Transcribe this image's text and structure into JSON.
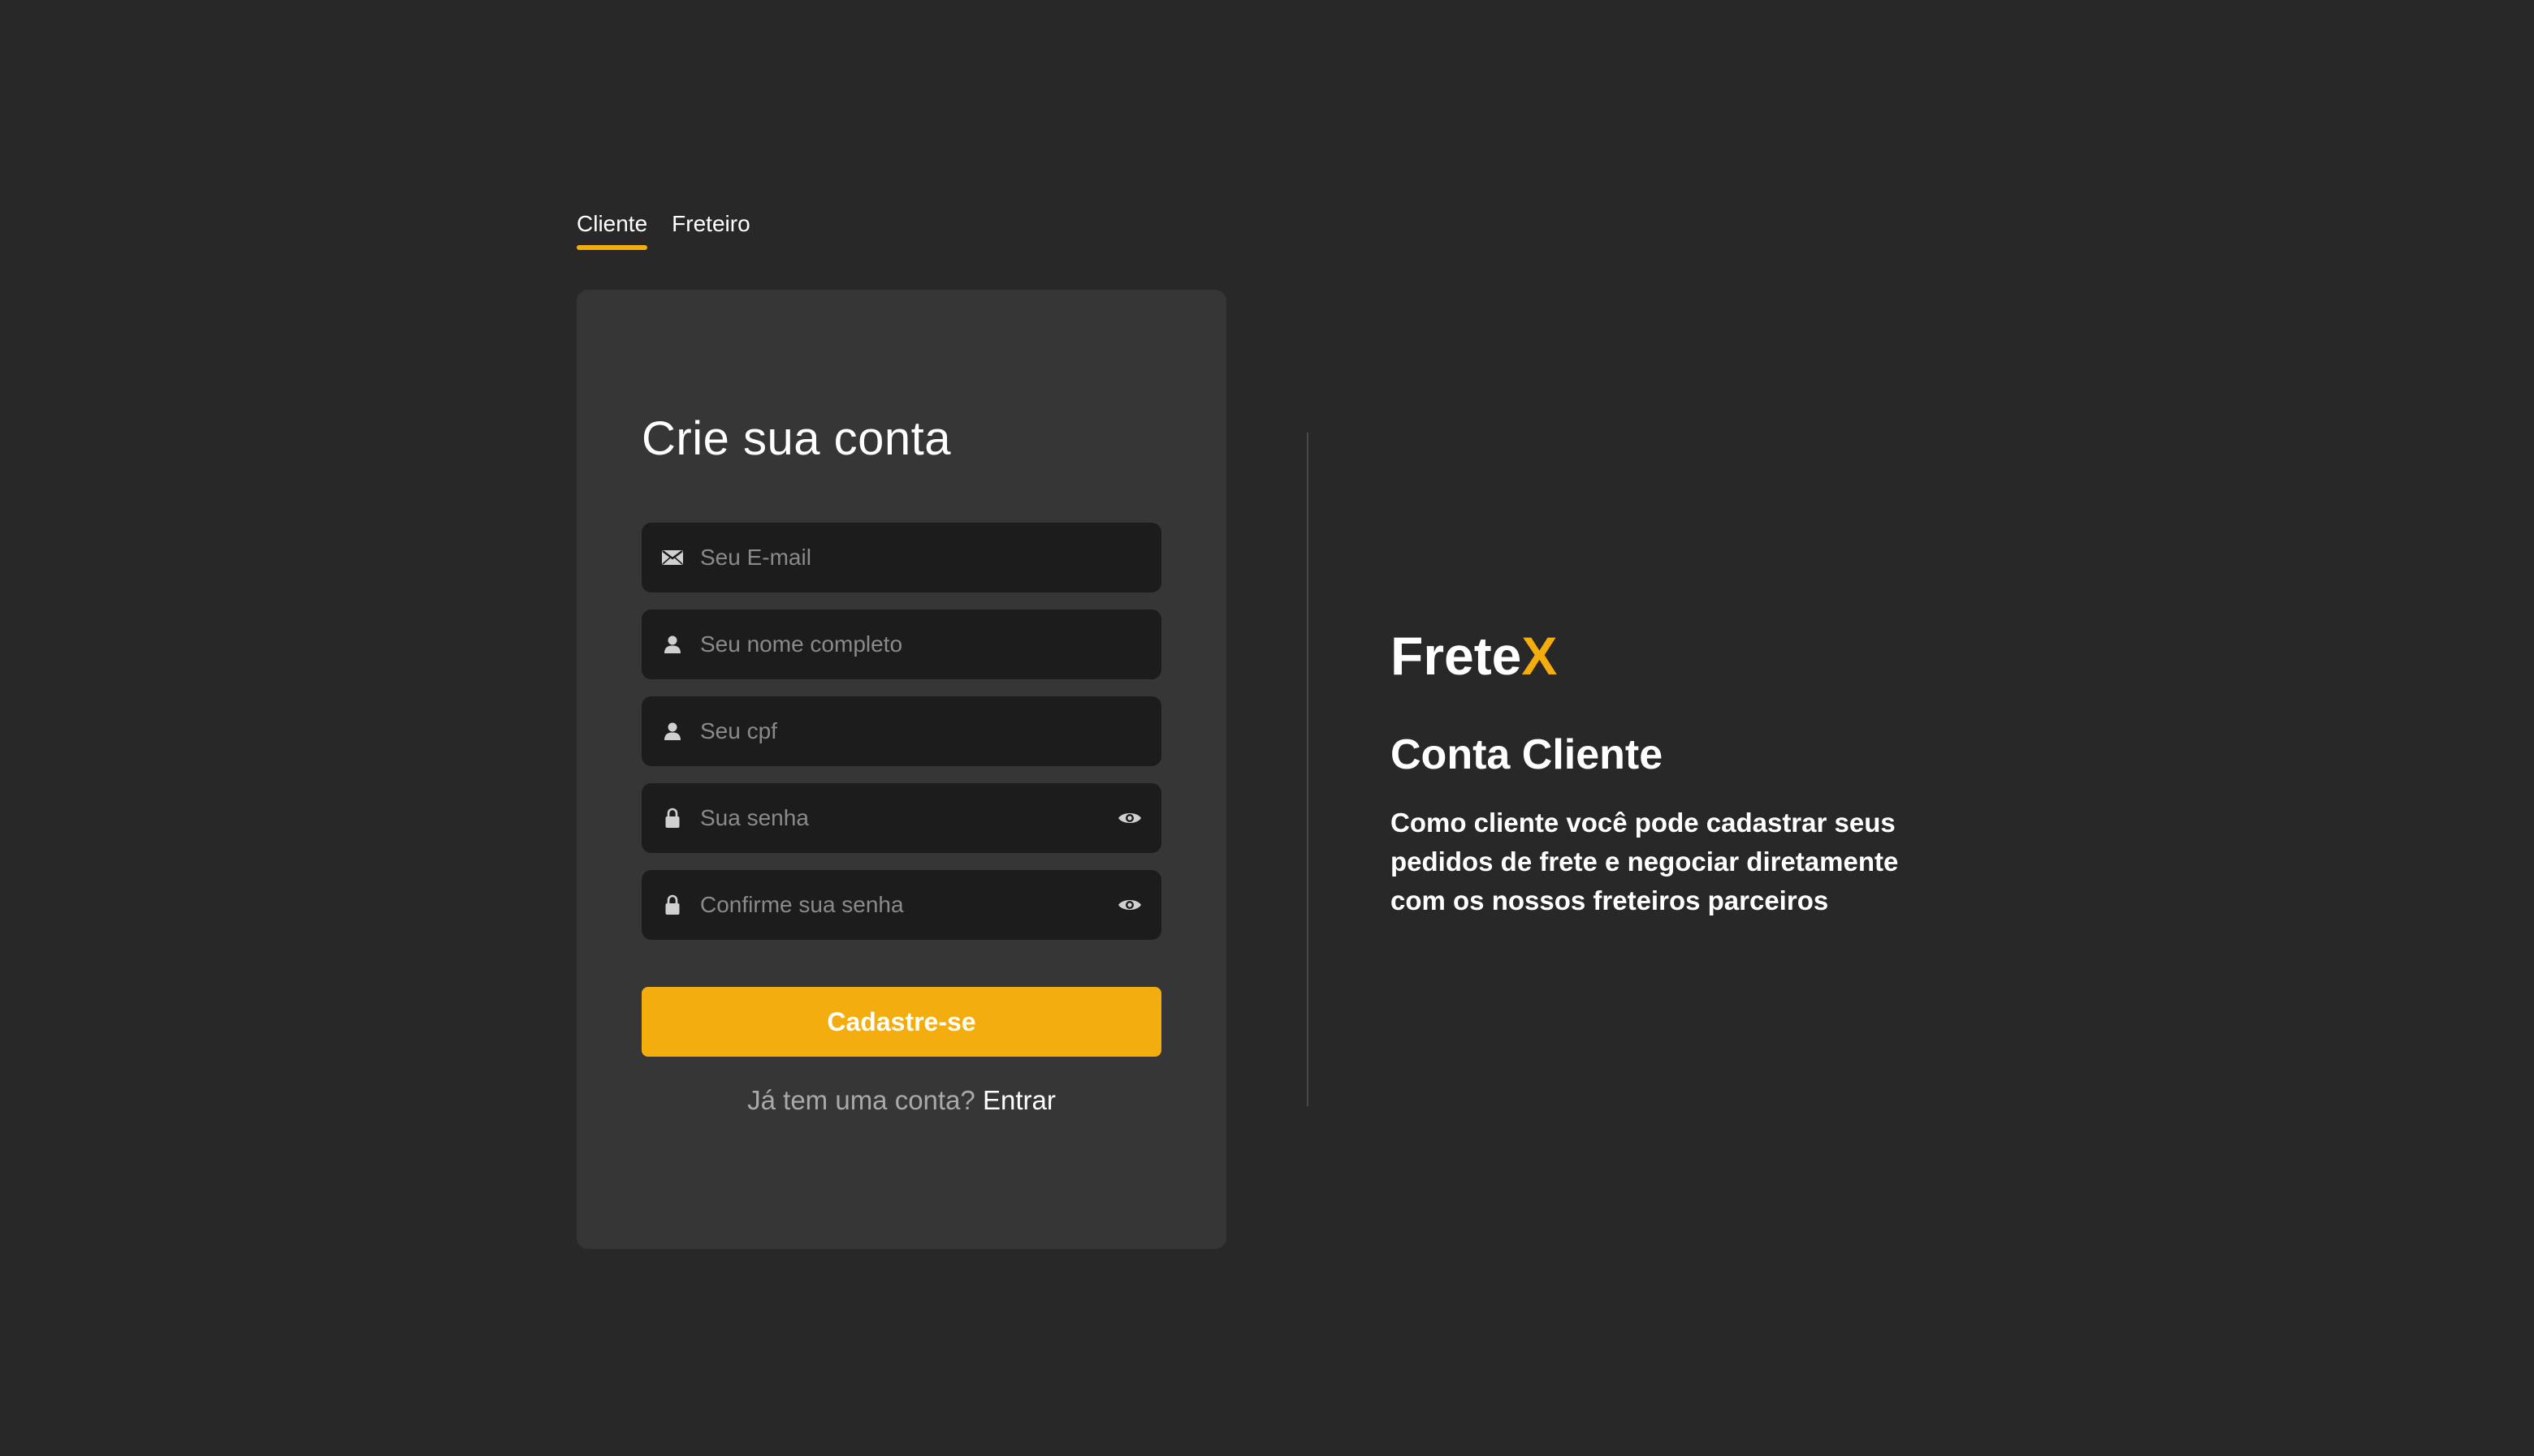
{
  "tabs": [
    {
      "label": "Cliente",
      "active": true
    },
    {
      "label": "Freteiro",
      "active": false
    }
  ],
  "form": {
    "title": "Crie sua conta",
    "fields": [
      {
        "placeholder": "Seu E-mail",
        "icon": "mail-icon",
        "value": ""
      },
      {
        "placeholder": "Seu nome completo",
        "icon": "user-icon",
        "value": ""
      },
      {
        "placeholder": "Seu cpf",
        "icon": "user-icon",
        "value": ""
      },
      {
        "placeholder": "Sua senha",
        "icon": "lock-icon",
        "value": "",
        "toggle_icon": "eye-icon"
      },
      {
        "placeholder": "Confirme sua senha",
        "icon": "lock-icon",
        "value": "",
        "toggle_icon": "eye-icon"
      }
    ],
    "submit_label": "Cadastre-se",
    "login_prompt": "Já tem uma conta?",
    "login_link": "Entrar"
  },
  "info": {
    "brand_main": "Frete",
    "brand_accent": "X",
    "title": "Conta Cliente",
    "description": "Como cliente você pode cadastrar seus pedidos de frete e negociar diretamente com os nossos freteiros parceiros"
  },
  "colors": {
    "background": "#282828",
    "card": "#363636",
    "input": "#1c1c1c",
    "accent": "#f4ad0e"
  }
}
